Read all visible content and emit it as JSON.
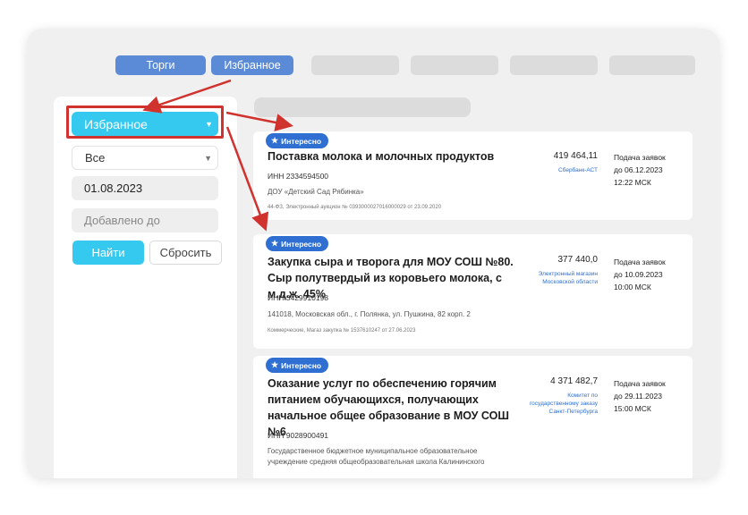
{
  "tabs": [
    {
      "label": "Торги"
    },
    {
      "label": "Избранное"
    }
  ],
  "filters": {
    "list_select": "Избранное",
    "status_select": "Все",
    "date_from": "01.08.2023",
    "date_to_placeholder": "Добавлено до",
    "find_label": "Найти",
    "reset_label": "Сбросить"
  },
  "badge_label": "Интересно",
  "tenders": [
    {
      "title": "Поставка молока и молочных продуктов",
      "inn": "ИНН 2334594500",
      "org": "ДОУ «Детский Сад Рябинка»",
      "meta": "44-ФЗ, Электронный аукцион № 0393000027016000029 от 23.09.2020",
      "price": "419 464,11",
      "platform": "Сбербанк-АСТ",
      "deadline_label": "Подача заявок",
      "deadline_date": "до 06.12.2023",
      "deadline_time": "12:22 МСК"
    },
    {
      "title": "Закупка сыра и творога для МОУ СОШ №80. Сыр полутвердый из коровьего молока, с м.д.ж. 45%",
      "inn": "ИНН 3429910198",
      "org": "141018, Московская обл., г. Полянка, ул. Пушкина, 82 корп. 2",
      "meta": "Коммерческие, Магаз закупка № 1537610247 от 27.06.2023",
      "price": "377 440,0",
      "platform": "Электронный магазин Московской области",
      "deadline_label": "Подача заявок",
      "deadline_date": "до 10.09.2023",
      "deadline_time": "10:00 МСК"
    },
    {
      "title": "Оказание услуг по обеспечению горячим питанием обучающихся, получающих начальное общее образование в МОУ СОШ №6",
      "inn": "ИНН 9028900491",
      "org": "Государственное бюджетное муниципальное образовательное учреждение средняя общеобразовательная школа Калининского",
      "meta": "",
      "price": "4 371 482,7",
      "platform": "Комитет по государственному заказу Санкт-Петербурга",
      "deadline_label": "Подача заявок",
      "deadline_date": "до 29.11.2023",
      "deadline_time": "15:00 МСК"
    }
  ],
  "colors": {
    "accent_blue": "#2e6fd1",
    "cyan": "#36c9f0",
    "highlight_red": "#d0322e"
  }
}
